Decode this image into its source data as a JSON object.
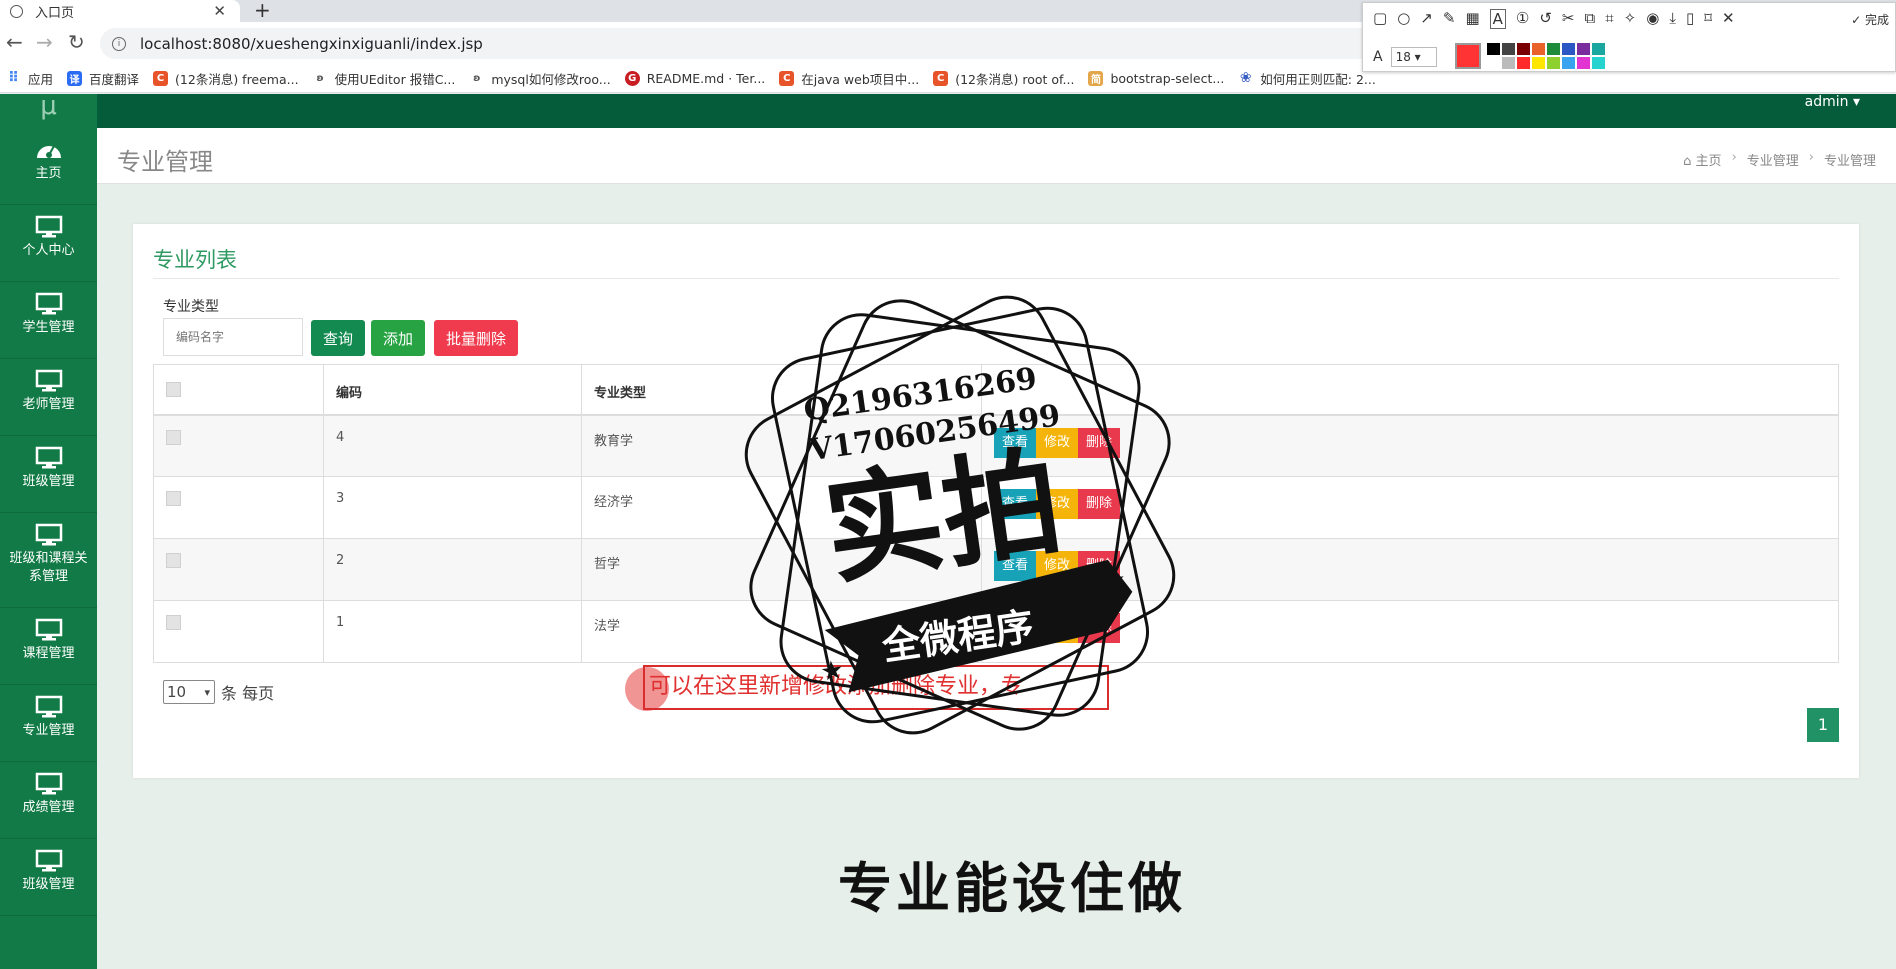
{
  "browser": {
    "tab_title": "入口页",
    "new_tab": "+",
    "url": "localhost:8080/xueshengxinxiguanli/index.jsp",
    "bookmarks": [
      {
        "label": "应用",
        "color": "#4285f4"
      },
      {
        "label": "百度翻译",
        "color": "#2a6df4"
      },
      {
        "label": "(12条消息) freema...",
        "color": "#e8542a"
      },
      {
        "label": "使用UEditor 报错C...",
        "color": "#555555"
      },
      {
        "label": "mysql如何修改roo...",
        "color": "#555555"
      },
      {
        "label": "README.md · Ter...",
        "color": "#c71d23"
      },
      {
        "label": "在java web项目中...",
        "color": "#e8542a"
      },
      {
        "label": "(12条消息) root of...",
        "color": "#e8542a"
      },
      {
        "label": "bootstrap-select...",
        "color": "#e3a64a"
      },
      {
        "label": "如何用正则匹配: 2...",
        "color": "#3a5fc4"
      }
    ]
  },
  "annotation_toolbar": {
    "done_label": "完成",
    "font_size": "18",
    "current_color": "#ff3333",
    "palette": [
      "#000000",
      "#444444",
      "#7a0000",
      "#e8622a",
      "#1e8a3c",
      "#2b57c4",
      "#7a2d9c",
      "#1aa7a0",
      "#ffffff",
      "#bbbbbb",
      "#ff2a2a",
      "#ffe600",
      "#8ed12e",
      "#3aa3f0",
      "#e234d0",
      "#26d3cf"
    ]
  },
  "topbar": {
    "user": "admin ▾"
  },
  "sidebar": {
    "logo": "μ",
    "items": [
      {
        "label": "主页",
        "icon": "dashboard-icon"
      },
      {
        "label": "个人中心",
        "icon": "monitor-icon"
      },
      {
        "label": "学生管理",
        "icon": "monitor-icon"
      },
      {
        "label": "老师管理",
        "icon": "monitor-icon"
      },
      {
        "label": "班级管理",
        "icon": "monitor-icon"
      },
      {
        "label": "班级和课程关系管理",
        "icon": "monitor-icon"
      },
      {
        "label": "课程管理",
        "icon": "monitor-icon"
      },
      {
        "label": "专业管理",
        "icon": "monitor-icon"
      },
      {
        "label": "成绩管理",
        "icon": "monitor-icon"
      },
      {
        "label": "班级管理",
        "icon": "monitor-icon"
      }
    ]
  },
  "header": {
    "title": "专业管理",
    "breadcrumb": [
      "主页",
      "专业管理",
      "专业管理"
    ]
  },
  "card": {
    "title": "专业列表",
    "filter_label": "专业类型",
    "search_placeholder": "编码名字",
    "buttons": {
      "query": "查询",
      "add": "添加",
      "batch_delete": "批量删除"
    },
    "columns": [
      "",
      "编码",
      "专业类型",
      ""
    ],
    "rows": [
      {
        "code": "4",
        "type": "教育学"
      },
      {
        "code": "3",
        "type": "经济学"
      },
      {
        "code": "2",
        "type": "哲学"
      },
      {
        "code": "1",
        "type": "法学"
      }
    ],
    "actions": {
      "view": "查看",
      "edit": "修改",
      "delete": "删除"
    },
    "page_size": "10",
    "page_size_suffix": "条 每页",
    "current_page": "1"
  },
  "annotation_note": "可以在这里新增修改添加删除专业，专",
  "bottom_heading": "专业能设住做",
  "watermark": {
    "qq": "Q2196316269",
    "v": "V17060256499",
    "main": "实拍",
    "banner": "全微程序"
  }
}
